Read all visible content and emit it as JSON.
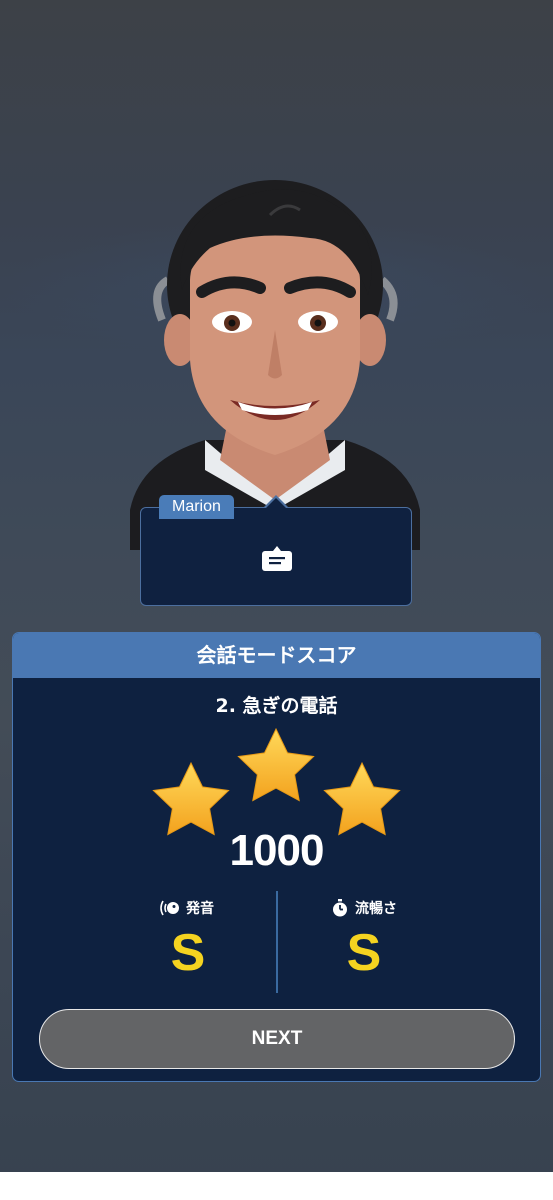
{
  "speaker": {
    "name": "Marion"
  },
  "score_card": {
    "title": "会話モードスコア",
    "lesson": "2. 急ぎの電話",
    "stars_earned": 3,
    "stars_total": 3,
    "score": "1000",
    "metrics": [
      {
        "label": "発音",
        "icon": "pronunciation-icon",
        "grade": "S"
      },
      {
        "label": "流暢さ",
        "icon": "stopwatch-icon",
        "grade": "S"
      }
    ],
    "next_label": "NEXT"
  },
  "colors": {
    "card_bg": "#0e2140",
    "header_blue": "#4a78b3",
    "grade_yellow": "#f5d320",
    "star_gold": "#f7b52a"
  }
}
